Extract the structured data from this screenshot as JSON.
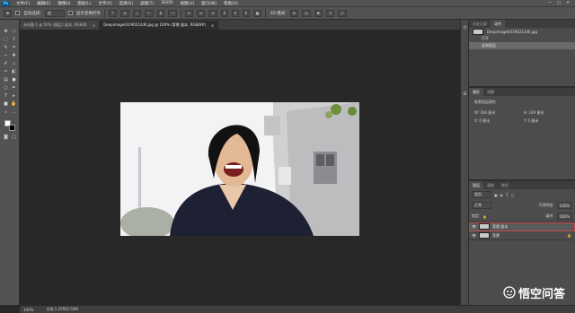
{
  "app": {
    "logo": "Ps"
  },
  "menubar": {
    "items": [
      "文件(F)",
      "编辑(E)",
      "图像(I)",
      "图层(L)",
      "文字(Y)",
      "选择(S)",
      "滤镜(T)",
      "3D(D)",
      "视图(V)",
      "窗口(W)",
      "帮助(H)"
    ],
    "window_controls": [
      "—",
      "□",
      "✕"
    ]
  },
  "options": {
    "auto_select_label": "自动选择:",
    "auto_select_value": "组",
    "show_transform_label": "显示变换控件",
    "mode_3d_label": "3D 模式:"
  },
  "tabs": [
    {
      "label": "未标题-1 @ 50% (图层1 副本, RGB/8)",
      "close": "×"
    },
    {
      "label": "Deepimage03190212d0.jpg @ 100% (背景 副本, RGB/8#)",
      "close": "×"
    }
  ],
  "history": {
    "tabs": [
      "历史记录",
      "动作"
    ],
    "snapshot": "Deepimage03190212d0.jpg",
    "items": [
      "打开",
      "复制图层"
    ]
  },
  "properties": {
    "tabs": [
      "属性",
      "调整"
    ],
    "title": "像素图层属性",
    "fields": [
      {
        "label": "W:",
        "value": "266 厘米"
      },
      {
        "label": "H:",
        "value": "149 厘米"
      },
      {
        "label": "X:",
        "value": "0 厘米"
      },
      {
        "label": "Y:",
        "value": "0 厘米"
      }
    ]
  },
  "layers": {
    "tabs": [
      "图层",
      "通道",
      "路径"
    ],
    "filter_label": "类型",
    "blend_mode": "正常",
    "opacity_label": "不透明度:",
    "opacity_value": "100%",
    "lock_label": "锁定:",
    "fill_label": "填充:",
    "fill_value": "100%",
    "items": [
      {
        "name": "背景 副本",
        "visible": "👁",
        "selected": true
      },
      {
        "name": "背景",
        "visible": "👁",
        "selected": false
      }
    ]
  },
  "status": {
    "zoom": "100%",
    "doc_info": "文档:1.25M/2.50M"
  },
  "watermark": {
    "text": "悟空问答"
  }
}
